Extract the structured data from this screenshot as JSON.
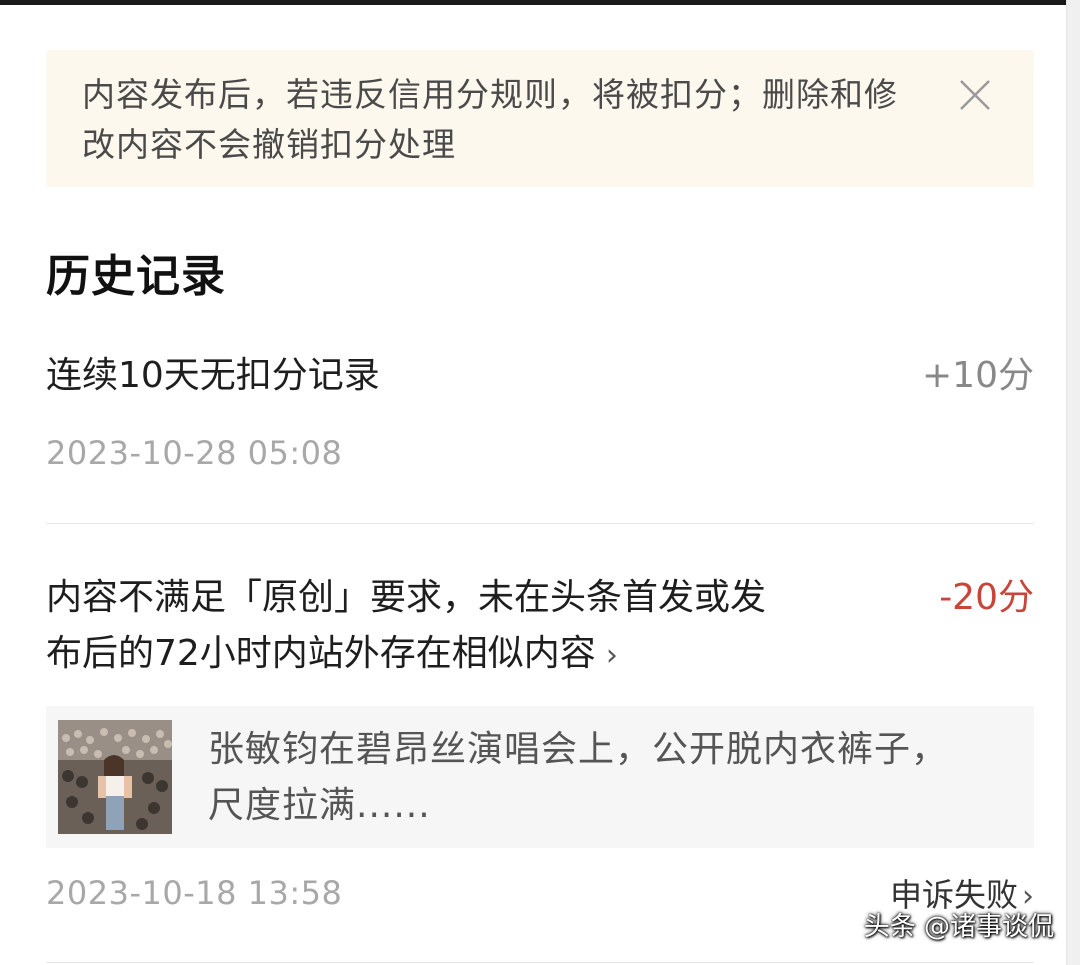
{
  "notice": {
    "text": "内容发布后，若违反信用分规则，将被扣分；删除和修改内容不会撤销扣分处理",
    "close_icon": "close-icon"
  },
  "history": {
    "title": "历史记录",
    "records": [
      {
        "title": "连续10天无扣分记录",
        "points": "+10分",
        "time": "2023-10-28 05:08"
      },
      {
        "title_line1": "内容不满足「原创」要求，未在头条首发或发",
        "title_line2": "布后的72小时内站外存在相似内容",
        "points": "-20分",
        "article": {
          "title": "张敏钧在碧昂丝演唱会上，公开脱内衣裤子，尺度拉满......"
        },
        "time": "2023-10-18 13:58",
        "appeal_label": "申诉失败"
      }
    ]
  },
  "watermark": "头条 @诸事谈侃",
  "colors": {
    "notice_bg": "#fdf8ee",
    "negative_points": "#c8453a",
    "positive_points": "#888888",
    "time_text": "#a8a8a8"
  }
}
